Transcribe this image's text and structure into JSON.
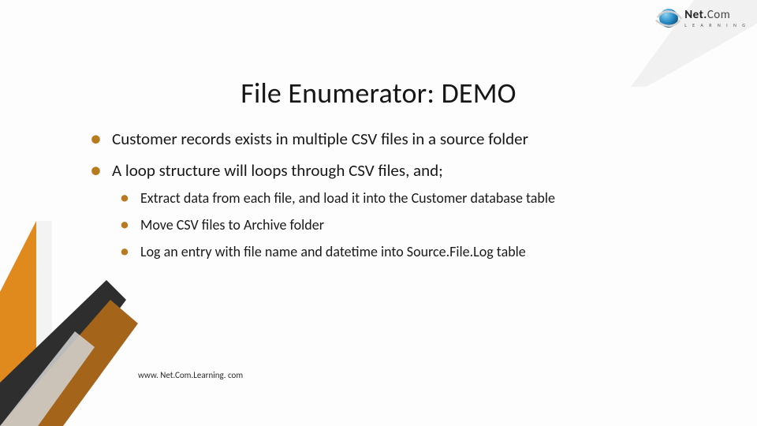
{
  "logo": {
    "brand_bold": "Net.",
    "brand_light": "Com",
    "tagline": "L E A R N I N G"
  },
  "title": "File Enumerator: DEMO",
  "bullets": {
    "b1": "Customer records exists in multiple CSV files in a source folder",
    "b2": "A loop structure will loops through CSV files, and;",
    "sub": {
      "s1": "Extract data from each file, and load it into the Customer database table",
      "s2": "Move CSV files to Archive folder",
      "s3": "Log an entry with file name and datetime into Source.File.Log table"
    }
  },
  "footer": "www. Net.Com.Learning. com"
}
